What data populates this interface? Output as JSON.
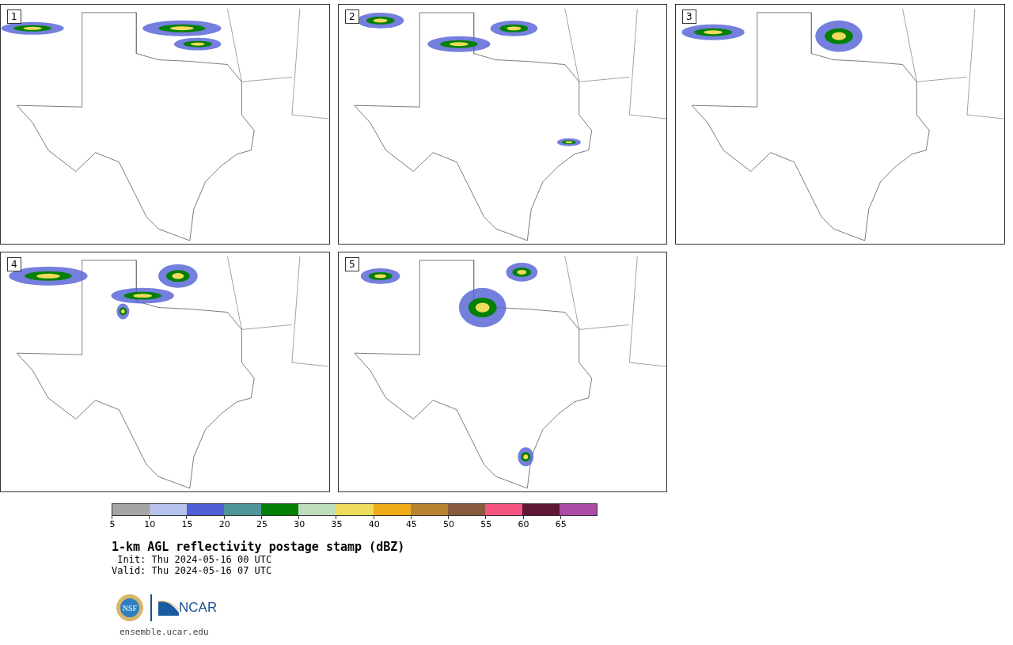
{
  "panels": [
    {
      "label": "1"
    },
    {
      "label": "2"
    },
    {
      "label": "3"
    },
    {
      "label": "4"
    },
    {
      "label": "5"
    }
  ],
  "colorbar": {
    "bins": [
      {
        "label": "5",
        "color": "#a5a5a5"
      },
      {
        "label": "10",
        "color": "#b6c2ec"
      },
      {
        "label": "15",
        "color": "#515fd6"
      },
      {
        "label": "20",
        "color": "#50959a"
      },
      {
        "label": "25",
        "color": "#048004"
      },
      {
        "label": "30",
        "color": "#bedebb"
      },
      {
        "label": "35",
        "color": "#efdb5c"
      },
      {
        "label": "40",
        "color": "#f0ab19"
      },
      {
        "label": "45",
        "color": "#b98231"
      },
      {
        "label": "50",
        "color": "#8a5a3f"
      },
      {
        "label": "55",
        "color": "#f5547f"
      },
      {
        "label": "60",
        "color": "#611736"
      },
      {
        "label": "65",
        "color": "#ac4ca5"
      }
    ]
  },
  "title": "1-km AGL reflectivity postage stamp (dBZ)",
  "init": " Init: Thu 2024-05-16 00 UTC",
  "valid": "Valid: Thu 2024-05-16 07 UTC",
  "logo": {
    "nsf": "NSF",
    "ncar": "NCAR"
  },
  "url": "ensemble.ucar.edu"
}
